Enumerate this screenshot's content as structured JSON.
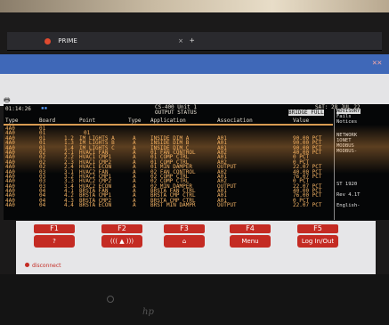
{
  "browser": {
    "tab_title": "PRIME",
    "close_glyph": "×",
    "newtab_glyph": "+"
  },
  "terminal": {
    "time": "01:14:26",
    "title_line1": "CS-400 Unit 1",
    "title_line2": "OUTPUT STATUS",
    "date": "SAT: 28 JUL 22",
    "mode": "BRIDGE FULL",
    "columns": [
      "Type",
      "Board",
      "Point",
      "Type",
      "Application",
      "Association",
      "Value"
    ],
    "rows": [
      [
        "4A0",
        "01",
        "",
        "",
        "",
        "",
        "",
        ""
      ],
      [
        "4A0",
        "01",
        "",
        "01",
        "",
        "",
        "",
        ""
      ],
      [
        "4A0",
        "01",
        "1.2",
        "IM LIGHTS A",
        "A",
        "INSIDE DIM A",
        "A01",
        "90.00 PCT"
      ],
      [
        "4A0",
        "01",
        "1.3",
        "IM LIGHTS B",
        "A",
        "INSIDE DIM B",
        "A01",
        "90.00 PCT"
      ],
      [
        "4A0",
        "01",
        "1.4",
        "IM LIGHTS C",
        "A",
        "INSIDE DIM C",
        "A01",
        "90.00 PCT"
      ],
      [
        "4A0",
        "02",
        "2.1",
        "HVAC1 FAN",
        "A",
        "01 FAN CONTROL",
        "A02",
        "40.00 PCT"
      ],
      [
        "4A0",
        "02",
        "2.2",
        "HVAC1 CMP1",
        "A",
        "01 COMP CTRL",
        "A01",
        "0 PCT"
      ],
      [
        "4A0",
        "02",
        "2.3",
        "HVAC1 CMP2",
        "A",
        "01 COMP CTRL",
        "A02",
        "0 PCT"
      ],
      [
        "4A0",
        "02",
        "2.4",
        "HVAC1 ECON",
        "A",
        "01 MIN DAMPER",
        "OUTPUT",
        "22.07 PCT"
      ],
      [
        "4A0",
        "03",
        "3.1",
        "HVAC2 FAN",
        "A",
        "02 FAN CONTROL",
        "A02",
        "40.00 PCT"
      ],
      [
        "4A0",
        "03",
        "3.2",
        "HVAC2 CMP1",
        "A",
        "02 COMP CTRL",
        "A01",
        "76.07 PCT"
      ],
      [
        "4A0",
        "03",
        "3.3",
        "HVAC2 CMP2",
        "A",
        "02 COMP CTRL",
        "A02",
        "0 PCT"
      ],
      [
        "4A0",
        "03",
        "3.4",
        "HVAC2 ECON",
        "A",
        "02 MIN DAMPER",
        "OUTPUT",
        "22.07 PCT"
      ],
      [
        "4A0",
        "04",
        "4.1",
        "BRSTA FAN",
        "A",
        "BRSTA FAN CTRL",
        "A01",
        "40.00 PCT"
      ],
      [
        "4A0",
        "04",
        "4.2",
        "BRSTA CMP1",
        "A",
        "BRSTA CMP CTRL",
        "A01",
        "76.00 PCT"
      ],
      [
        "4A0",
        "04",
        "4.3",
        "BRSTA CMP2",
        "A",
        "BRSTA CMP CTRL",
        "A01",
        "0 PCT"
      ],
      [
        "4A0",
        "04",
        "4.4",
        "BRSTA ECON",
        "A",
        "BRST MIN DAMPR",
        "OUTPUT",
        "22.07 PCT"
      ]
    ],
    "side": {
      "advisory_label": "ADVISORY",
      "fails": "Fails",
      "notices": "Notices",
      "network_label": "NETWORK",
      "net1": "1ONET",
      "net2": "MODBUS",
      "net3": "MODBUS-",
      "ip": "ST 1920",
      "rev": "Rev 4.1T",
      "lang": "English-"
    }
  },
  "function_keys": [
    {
      "label": "F1",
      "icon": "?"
    },
    {
      "label": "F2",
      "icon": "((( ▲ )))"
    },
    {
      "label": "F3",
      "icon": "⌂"
    },
    {
      "label": "F4",
      "icon": "Menu"
    },
    {
      "label": "F5",
      "icon": "Log In/Out"
    }
  ],
  "status": {
    "disconnect": "disconnect"
  },
  "bezel": {
    "logo": "hp"
  }
}
